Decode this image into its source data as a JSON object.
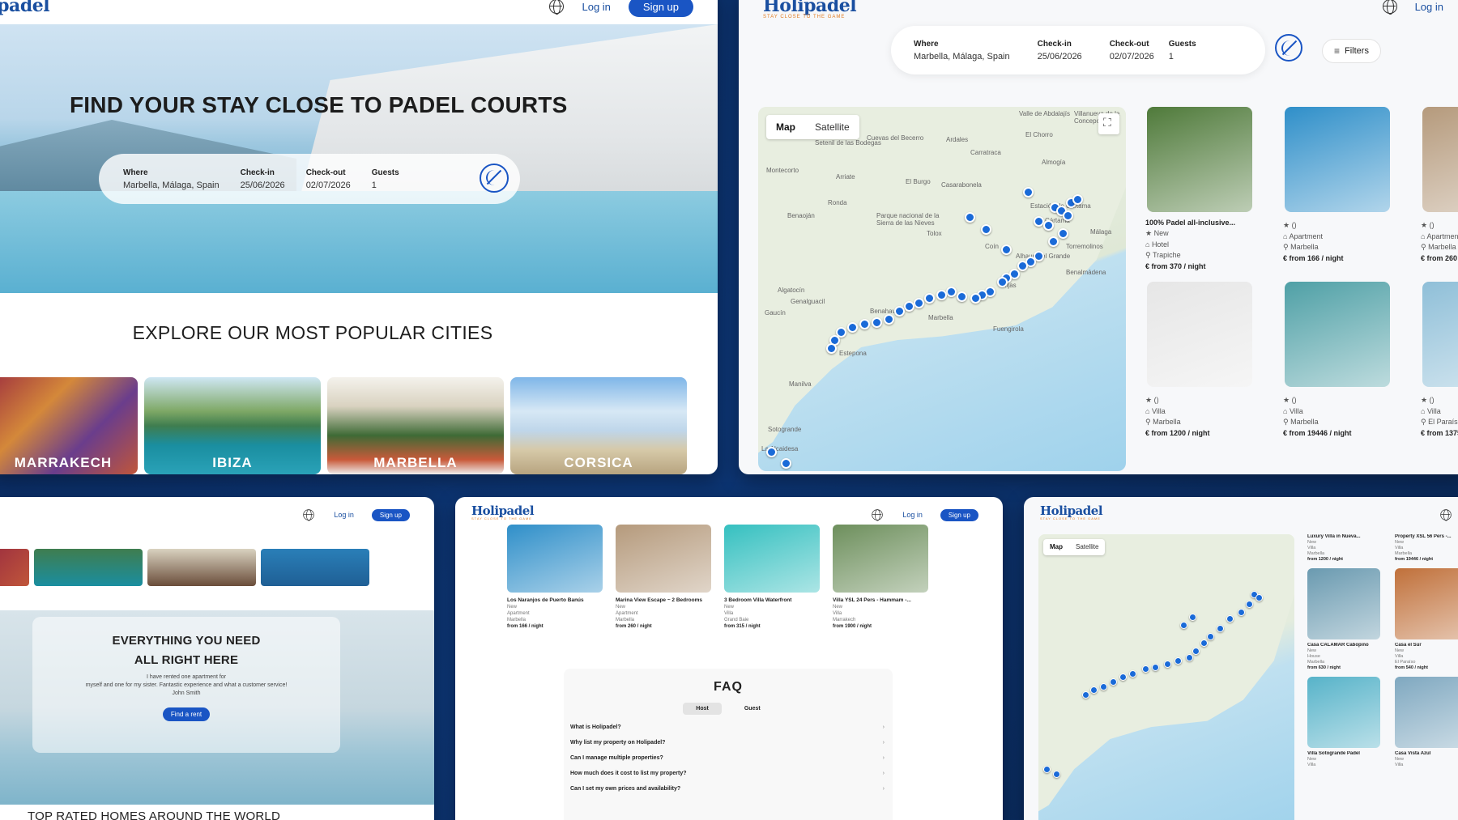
{
  "brand": {
    "logo": "Holipadel",
    "tagline": "STAY CLOSE TO THE GAME"
  },
  "nav": {
    "login": "Log in",
    "signup": "Sign up"
  },
  "search": {
    "where_label": "Where",
    "where_value": "Marbella, Málaga, Spain",
    "checkin_label": "Check-in",
    "checkin_value": "25/06/2026",
    "checkout_label": "Check-out",
    "checkout_value": "02/07/2026",
    "guests_label": "Guests",
    "guests_value": "1"
  },
  "hero": {
    "title": "FIND YOUR STAY CLOSE TO PADEL COURTS"
  },
  "explore": {
    "title": "EXPLORE OUR MOST POPULAR CITIES",
    "cities": [
      "MARRAKECH",
      "IBIZA",
      "MARBELLA",
      "CORSICA"
    ]
  },
  "map": {
    "filters": "Filters",
    "toggle": [
      "Map",
      "Satellite"
    ],
    "places": [
      "Valle de Abdalajís",
      "Villanueva de la Concepción",
      "El Chorro",
      "Setenil de las Bodegas",
      "Cuevas del Becerro",
      "Ardales",
      "Carratraca",
      "Almogía",
      "Montecorto",
      "Arriate",
      "El Burgo",
      "Casarabonela",
      "Ronda",
      "Benaoján",
      "Parque nacional de la Sierra de las Nieves",
      "Tolox",
      "Coín",
      "Alhaurín el Grande",
      "Estación de Cártama",
      "Cártama",
      "Algatocín",
      "Genalguacil",
      "Gaucín",
      "Benahavís",
      "Marbella",
      "Estepona",
      "Manilva",
      "Sotogrande",
      "La Alcaidesa",
      "Fuengirola",
      "Mijas",
      "Benalmádena",
      "Torremolinos",
      "Málaga"
    ]
  },
  "listings": [
    {
      "title": "100% Padel all-inclusive...",
      "rating": "New",
      "type": "Hotel",
      "location": "Trapiche",
      "price": "from 370 / night",
      "color": "#4f7a3a"
    },
    {
      "title": "",
      "rating": "()",
      "type": "Apartment",
      "location": "Marbella",
      "price": "from 166 / night",
      "color": "#2f8fc9"
    },
    {
      "title": "",
      "rating": "()",
      "type": "Apartment",
      "location": "Marbella",
      "price": "from 260 / n",
      "color": "#b59a7c"
    },
    {
      "title": "",
      "rating": "()",
      "type": "Villa",
      "location": "Marbella",
      "price": "from 1200 / night",
      "color": "#e6e6e6"
    },
    {
      "title": "",
      "rating": "()",
      "type": "Villa",
      "location": "Marbella",
      "price": "from 19446 / night",
      "color": "#4fa0a6"
    },
    {
      "title": "",
      "rating": "()",
      "type": "Villa",
      "location": "El Paraíso",
      "price": "from 1375 /",
      "color": "#8fbfd8"
    }
  ],
  "need": {
    "title_line1": "EVERYTHING YOU NEED",
    "title_line2": "ALL RIGHT HERE",
    "quote_line1": "I have rented one apartment for",
    "quote_line2": "myself and one for my sister. Fantastic experience and what a customer service!",
    "quote_author": "John Smith",
    "cta": "Find a rent",
    "bottom_title": "TOP RATED HOMES AROUND THE WORLD"
  },
  "faq_listings": [
    {
      "title": "Los Naranjos de Puerto Banús",
      "rating": "New",
      "type": "Apartment",
      "location": "Marbella",
      "price": "from 166 / night",
      "color": "#2f8fc9"
    },
    {
      "title": "Marina View Escape ~ 2 Bedrooms",
      "rating": "New",
      "type": "Apartment",
      "location": "Marbella",
      "price": "from 260 / night",
      "color": "#b59a7c"
    },
    {
      "title": "3 Bedroom Villa Waterfront",
      "rating": "New",
      "type": "Villa",
      "location": "Grand Baie",
      "price": "from 315 / night",
      "color": "#35c0c0"
    },
    {
      "title": "Villa YSL 24 Pers - Hammam -...",
      "rating": "New",
      "type": "Villa",
      "location": "Marrakech",
      "price": "from 1900 / night",
      "color": "#6d8f5c"
    }
  ],
  "faq": {
    "title": "FAQ",
    "tabs": [
      "Host",
      "Guest"
    ],
    "questions": [
      "What is Holipadel?",
      "Why list my property on Holipadel?",
      "Can I manage multiple properties?",
      "How much does it cost to list my property?",
      "Can I set my own prices and availability?"
    ]
  },
  "map2_listings": [
    {
      "title": "Luxury Villa in Nueva...",
      "rating": "New",
      "type": "Villa",
      "location": "Marbella",
      "price": "from 1200 / night",
      "color": "#e8e8e8"
    },
    {
      "title": "Property XSL 56 Pers -...",
      "rating": "New",
      "type": "Villa",
      "location": "Marbella",
      "price": "from 19446 / night",
      "color": "#e8e8e8"
    },
    {
      "title": "Casa CALAMAR Cabopino",
      "rating": "New",
      "type": "House",
      "location": "Marbella",
      "price": "from 630 / night",
      "color": "#6a9ab0"
    },
    {
      "title": "Casa el Sur",
      "rating": "New",
      "type": "Villa",
      "location": "El Paraíso",
      "price": "from 540 / night",
      "color": "#c0703a"
    },
    {
      "title": "Villa Sotogrande Padel",
      "rating": "New",
      "type": "Villa",
      "location": "",
      "price": "",
      "color": "#57b3c9"
    },
    {
      "title": "Casa Vista Azul",
      "rating": "New",
      "type": "Villa",
      "location": "",
      "price": "",
      "color": "#7fa8c0"
    }
  ],
  "colors": {
    "brand_blue": "#1a55c4",
    "pin_blue": "#1a6ad8",
    "background": "#0b2a5e"
  }
}
